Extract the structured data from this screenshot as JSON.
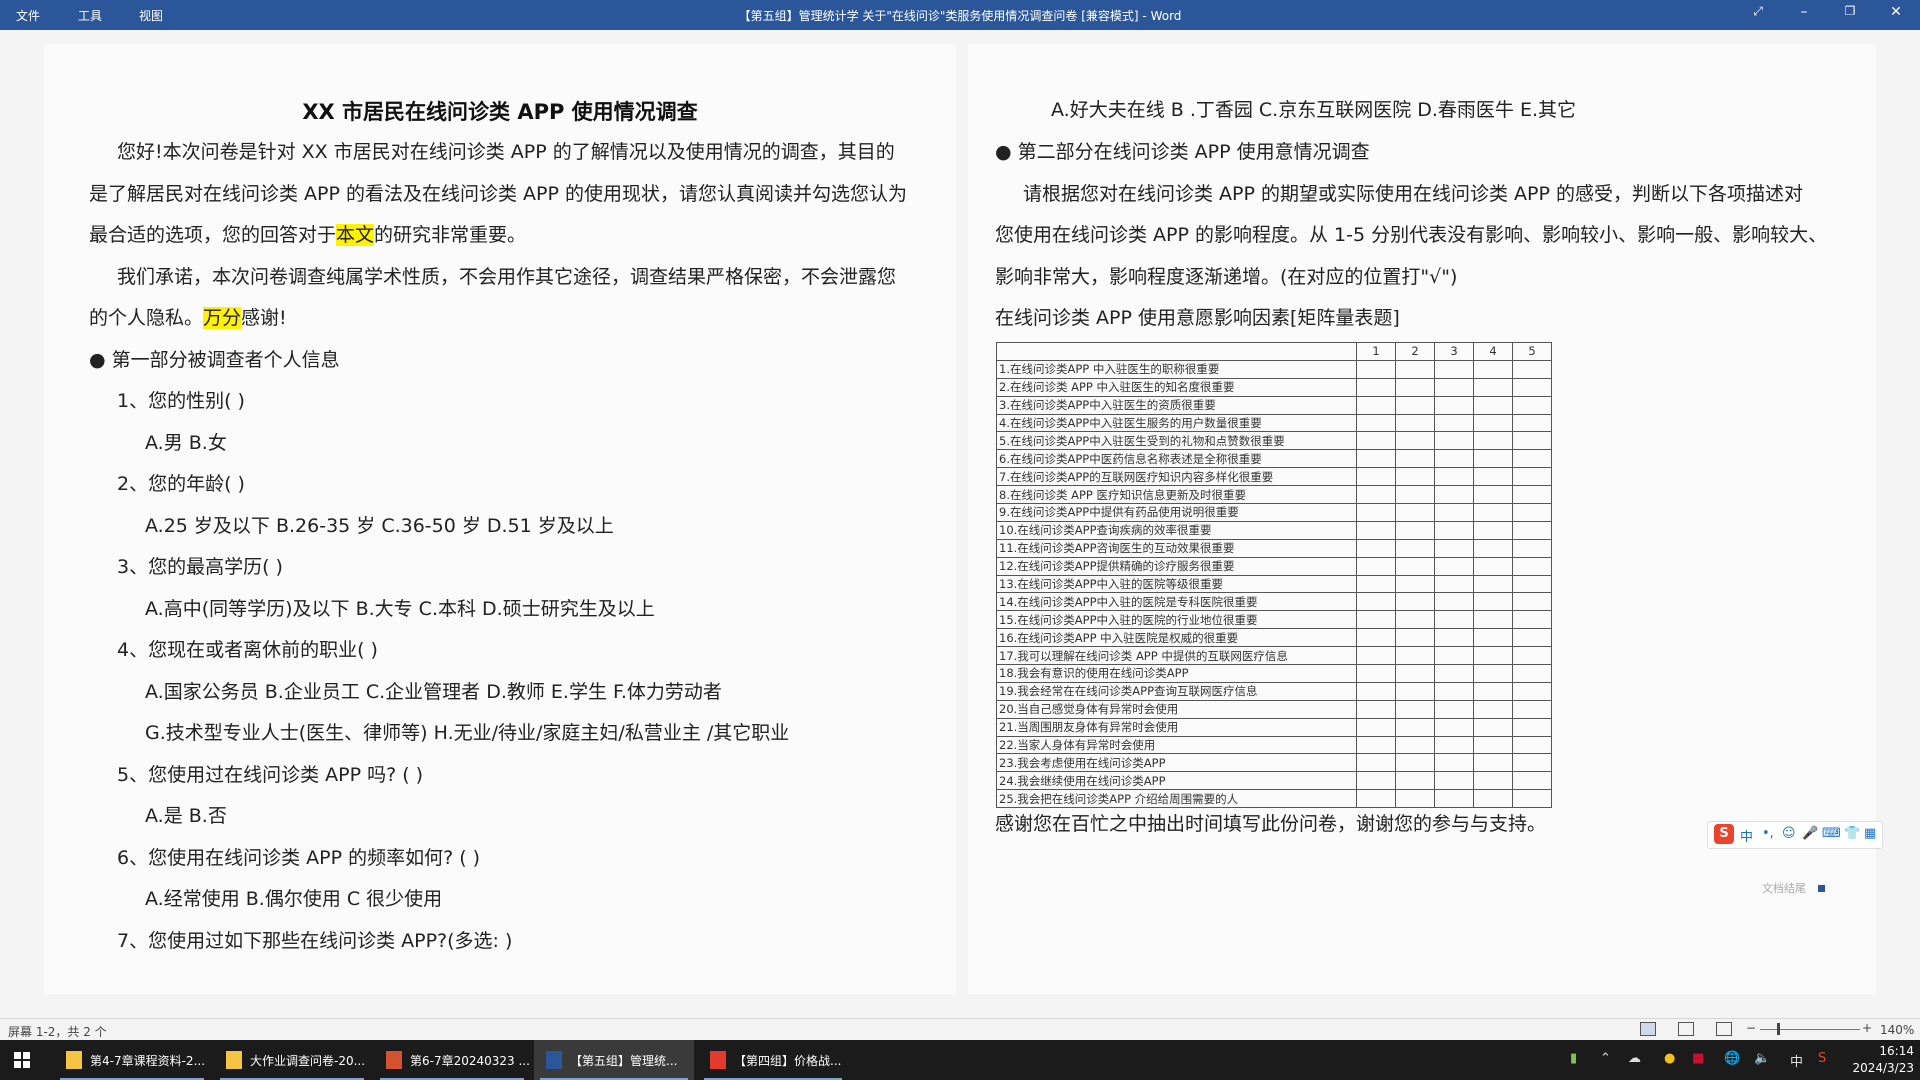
{
  "titlebar": {
    "menu": [
      "文件",
      "工具",
      "视图"
    ],
    "title": "【第五组】管理统计学 关于\"在线问诊\"类服务使用情况调查问卷 [兼容模式] - Word"
  },
  "left": {
    "title": "XX 市居民在线问诊类 APP 使用情况调查",
    "intro_l1": "您好!本次问卷是针对 XX 市居民对在线问诊类 APP 的了解情况以及使用情况的调查，其目的",
    "intro_l2": "是了解居民对在线问诊类 APP 的看法及在线问诊类 APP 的使用现状，请您认真阅读并勾选您认为",
    "intro_l3a": "最合适的选项，您的回答对于",
    "intro_l3b": "本文",
    "intro_l3c": "的研究非常重要。",
    "promise_l1": "我们承诺，本次问卷调查纯属学术性质，不会用作其它途径，调查结果严格保密，不会泄露您",
    "promise_l2a": "的个人隐私。",
    "promise_l2b": "万分",
    "promise_l2c": "感谢!",
    "part1": "● 第一部分被调查者个人信息",
    "q1": "1、您的性别( )",
    "q1o": "A.男 B.女",
    "q2": "2、您的年龄( )",
    "q2o": "A.25 岁及以下 B.26-35 岁 C.36-50 岁 D.51 岁及以上",
    "q3": "3、您的最高学历( )",
    "q3o": "A.高中(同等学历)及以下 B.大专  C.本科 D.硕士研究生及以上",
    "q4": "4、您现在或者离休前的职业( )",
    "q4o1": "A.国家公务员 B.企业员工 C.企业管理者 D.教师 E.学生 F.体力劳动者",
    "q4o2": "G.技术型专业人士(医生、律师等) H.无业/待业/家庭主妇/私营业主 /其它职业",
    "q5": "5、您使用过在线问诊类 APP 吗? ( )",
    "q5o": "A.是 B.否",
    "q6": "6、您使用在线问诊类 APP 的频率如何? ( )",
    "q6o": "A.经常使用 B.偶尔使用 C 很少使用",
    "q7": "7、您使用过如下那些在线问诊类 APP?(多选:        )"
  },
  "right": {
    "q7o": "A.好大夫在线 B .丁香园 C.京东互联网医院 D.春雨医牛 E.其它",
    "part2": "● 第二部分在线问诊类 APP 使用意情况调查",
    "inst_l1": "请根据您对在线问诊类 APP 的期望或实际使用在线问诊类 APP 的感受，判断以下各项描述对",
    "inst_l2": "您使用在线问诊类 APP 的影响程度。从 1-5 分别代表没有影响、影响较小、影响一般、影响较大、",
    "inst_l3": "影响非常大，影响程度逐渐递增。(在对应的位置打\"√\")",
    "matrix_title": "在线问诊类 APP 使用意愿影响因素[矩阵量表题]",
    "scale": [
      "1",
      "2",
      "3",
      "4",
      "5"
    ],
    "items": [
      "1.在线问诊类APP 中入驻医生的职称很重要",
      "2.在线问诊类 APP 中入驻医生的知名度很重要",
      "3.在线问诊类APP中入驻医生的资质很重要",
      "4.在线问诊类APP中入驻医生服务的用户数量很重要",
      "5.在线问诊类APP中入驻医生受到的礼物和点赞数很重要",
      "6.在线问诊类APP中医药信息名称表述是全称很重要",
      "7.在线问诊类APP的互联网医疗知识内容多样化很重要",
      "8.在线问诊类 APP 医疗知识信息更新及时很重要",
      "9.在线问诊类APP中提供有药品使用说明很重要",
      "10.在线问诊类APP查询疾病的效率很重要",
      "11.在线问诊类APP咨询医生的互动效果很重要",
      "12.在线问诊类APP提供精确的诊疗服务很重要",
      "13.在线问诊类APP中入驻的医院等级很重要",
      "14.在线问诊类APP中入驻的医院是专科医院很重要",
      "15.在线问诊类APP中入驻的医院的行业地位很重要",
      "16.在线问诊类APP 中入驻医院是权威的很重要",
      "17.我可以理解在线问诊类 APP 中提供的互联网医疗信息",
      "18.我会有意识的使用在线问诊类APP",
      "19.我会经常在在线问诊类APP查询互联网医疗信息",
      "20.当自己感觉身体有异常时会使用",
      "21.当周围朋友身体有异常时会使用",
      "22.当家人身体有异常时会使用",
      "23.我会考虑使用在线问诊类APP",
      "24.我会继续使用在线问诊类APP",
      "25.我会把在线问诊类APP 介绍给周围需要的人"
    ],
    "thanks": "感谢您在百忙之中抽出时间填写此份问卷，谢谢您的参与与支持。",
    "doc_end": "文档结尾"
  },
  "ime": {
    "logo": "S",
    "mode": "中",
    "icons": [
      "•,",
      "☺",
      "🎤",
      "⌨",
      "👕",
      "▦"
    ]
  },
  "statusbar": {
    "screen": "屏幕 1-2，共 2 个",
    "zoom": "140%",
    "minus": "−",
    "plus": "+"
  },
  "taskbar": {
    "tasks": [
      {
        "label": "第4-7章课程资料-2...",
        "icon": "folder-icon",
        "color": "#f4c542"
      },
      {
        "label": "大作业调查问卷-20...",
        "icon": "folder-icon",
        "color": "#f4c542"
      },
      {
        "label": "第6-7章20240323 ...",
        "icon": "powerpoint-icon",
        "color": "#d35230"
      },
      {
        "label": "【第五组】管理统...",
        "icon": "word-icon",
        "color": "#2b579a"
      },
      {
        "label": "【第四组】价格战...",
        "icon": "pdf-icon",
        "color": "#e23b2e"
      }
    ],
    "time": "16:14",
    "date": "2024/3/23",
    "lang": "中"
  }
}
